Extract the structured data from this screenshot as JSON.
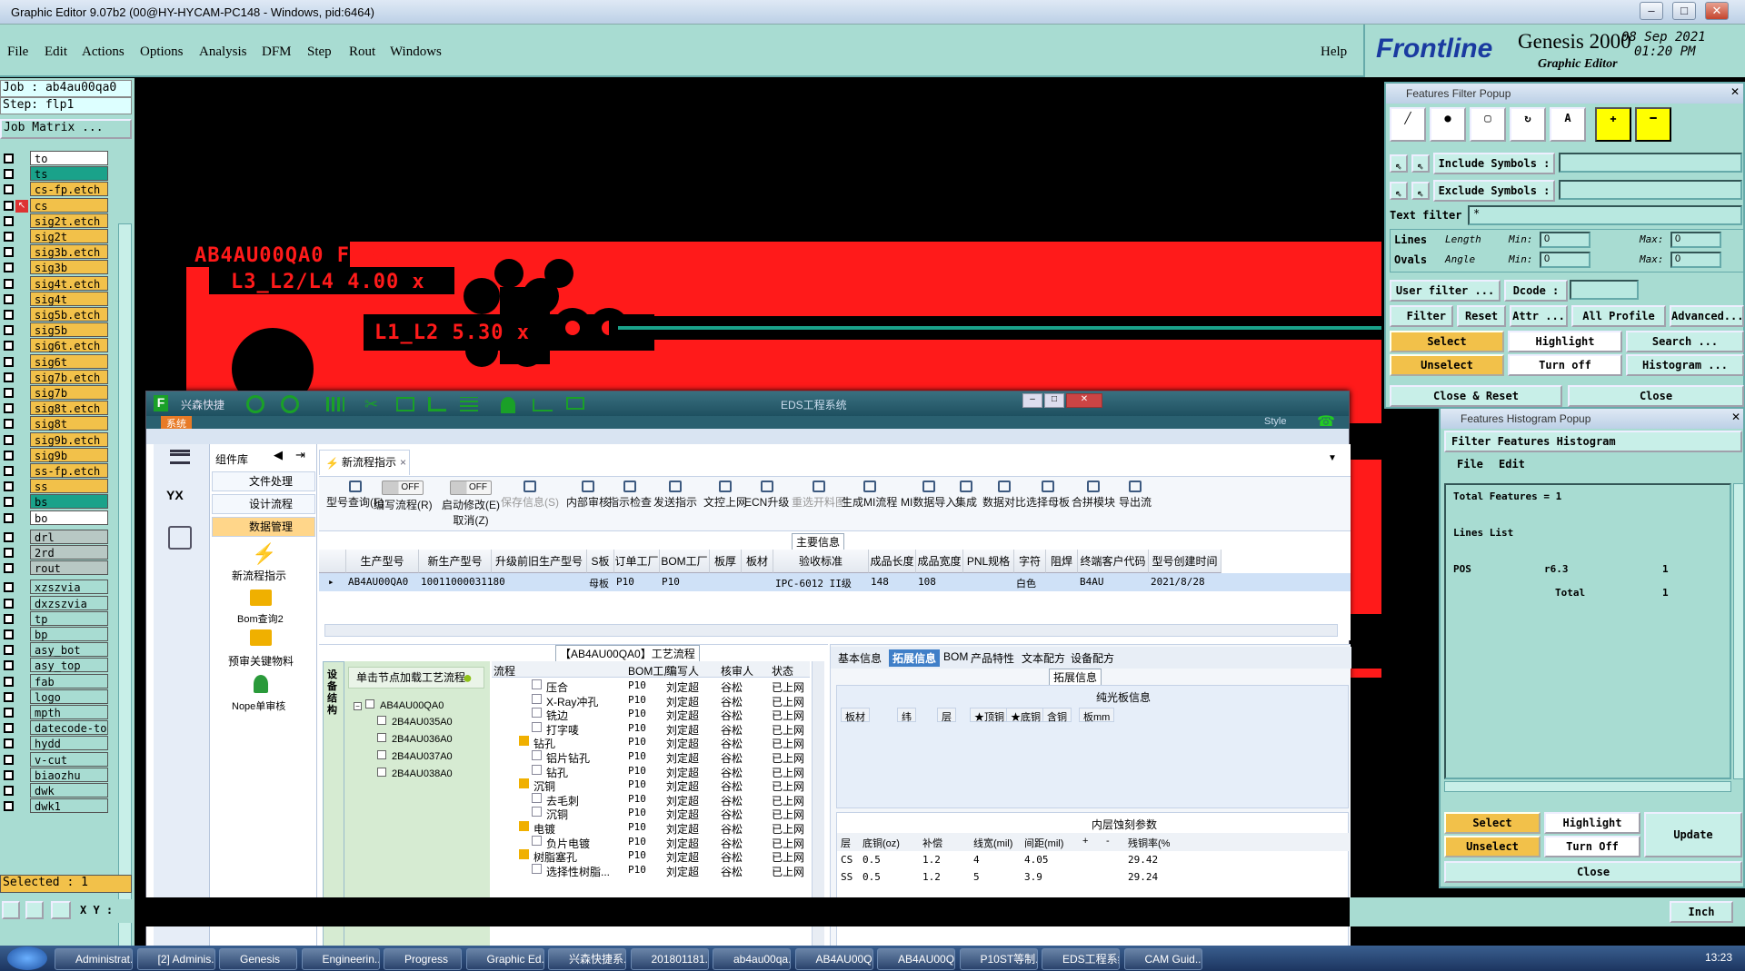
{
  "window": {
    "title": "Graphic Editor 9.07b2 (00@HY-HYCAM-PC148 - Windows, pid:6464)"
  },
  "menu": [
    "File",
    "Edit",
    "Actions",
    "Options",
    "Analysis",
    "DFM",
    "Step",
    "Rout",
    "Windows"
  ],
  "help": "Help",
  "brand": {
    "logo": "Frontline",
    "product": "Genesis 2000",
    "subtitle": "Graphic Editor",
    "date": "08 Sep 2021",
    "time": "01:20 PM"
  },
  "left": {
    "job": "Job : ab4au00qa0",
    "step": "Step: flp1",
    "matrix": "Job Matrix ...",
    "selected": "Selected : 1",
    "xy": "X Y :"
  },
  "layers": [
    {
      "name": "to",
      "color": "#ffffff"
    },
    {
      "name": "ts",
      "color": "#1aa28a"
    },
    {
      "name": "cs-fp.etch",
      "color": "#f2c14a"
    },
    {
      "name": "cs",
      "color": "#f2c14a",
      "active": true
    },
    {
      "name": "sig2t.etch",
      "color": "#f2c14a"
    },
    {
      "name": "sig2t",
      "color": "#f2c14a"
    },
    {
      "name": "sig3b.etch",
      "color": "#f2c14a"
    },
    {
      "name": "sig3b",
      "color": "#f2c14a"
    },
    {
      "name": "sig4t.etch",
      "color": "#f2c14a"
    },
    {
      "name": "sig4t",
      "color": "#f2c14a"
    },
    {
      "name": "sig5b.etch",
      "color": "#f2c14a"
    },
    {
      "name": "sig5b",
      "color": "#f2c14a"
    },
    {
      "name": "sig6t.etch",
      "color": "#f2c14a"
    },
    {
      "name": "sig6t",
      "color": "#f2c14a"
    },
    {
      "name": "sig7b.etch",
      "color": "#f2c14a"
    },
    {
      "name": "sig7b",
      "color": "#f2c14a"
    },
    {
      "name": "sig8t.etch",
      "color": "#f2c14a"
    },
    {
      "name": "sig8t",
      "color": "#f2c14a"
    },
    {
      "name": "sig9b.etch",
      "color": "#f2c14a"
    },
    {
      "name": "sig9b",
      "color": "#f2c14a"
    },
    {
      "name": "ss-fp.etch",
      "color": "#f2c14a"
    },
    {
      "name": "ss",
      "color": "#f2c14a"
    },
    {
      "name": "bs",
      "color": "#1aa28a"
    },
    {
      "name": "bo",
      "color": "#ffffff"
    },
    {
      "name": "drl",
      "color": "#b8c8c4"
    },
    {
      "name": "2rd",
      "color": "#b8c8c4"
    },
    {
      "name": "rout",
      "color": "#b8c8c4"
    },
    {
      "name": "xzszvia",
      "color": "#a8dcd2"
    },
    {
      "name": "dxzszvia",
      "color": "#a8dcd2"
    },
    {
      "name": "tp",
      "color": "#a8dcd2"
    },
    {
      "name": "bp",
      "color": "#a8dcd2"
    },
    {
      "name": "asy_bot",
      "color": "#a8dcd2"
    },
    {
      "name": "asy_top",
      "color": "#a8dcd2"
    },
    {
      "name": "fab",
      "color": "#a8dcd2"
    },
    {
      "name": "logo",
      "color": "#a8dcd2"
    },
    {
      "name": "mpth",
      "color": "#a8dcd2"
    },
    {
      "name": "datecode-to",
      "color": "#a8dcd2"
    },
    {
      "name": "hydd",
      "color": "#a8dcd2"
    },
    {
      "name": "v-cut",
      "color": "#a8dcd2"
    },
    {
      "name": "biaozhu",
      "color": "#a8dcd2"
    },
    {
      "name": "dwk",
      "color": "#a8dcd2"
    },
    {
      "name": "dwk1",
      "color": "#a8dcd2"
    }
  ],
  "board": {
    "l1": "AB4AU00QA0 FLP1",
    "l2": "L3_L2/L4 4.00 x",
    "l3": "L1_L2 5.30 x"
  },
  "eds": {
    "title": "EDS工程系统",
    "brand": "兴森快捷",
    "sys_tab": "系统",
    "style_label": "Style",
    "lib_title": "组件库",
    "lib_items": [
      "文件处理",
      "设计流程",
      "数据管理"
    ],
    "lib_icons": [
      "新流程指示",
      "Bom查询2",
      "预审关键物料",
      "Nope单审核"
    ],
    "tab": "新流程指示",
    "tools": [
      {
        "label": "型号查询(F)"
      },
      {
        "label": "编写流程(R)",
        "toggle": "OFF"
      },
      {
        "label": "启动修改(E)",
        "sub": "取消(Z)",
        "toggle": "OFF"
      },
      {
        "label": "保存信息(S)"
      },
      {
        "label": "内部审核"
      },
      {
        "label": "指示检查"
      },
      {
        "label": "发送指示"
      },
      {
        "label": "文控上网"
      },
      {
        "label": "ECN升级"
      },
      {
        "label": "重选开料图"
      },
      {
        "label": "生成MI流程"
      },
      {
        "label": "MI数据导入"
      },
      {
        "label": "集成"
      },
      {
        "label": "数据对比"
      },
      {
        "label": "选择母板"
      },
      {
        "label": "合拼模块"
      },
      {
        "label": "导出流"
      }
    ],
    "main_info": "主要信息",
    "grid_headers": [
      "生产型号",
      "新生产型号",
      "升级前旧生产型号",
      "S板",
      "订单工厂",
      "BOM工厂",
      "板厚",
      "板材",
      "验收标准",
      "成品长度",
      "成品宽度",
      "PNL规格",
      "字符",
      "阻焊",
      "终端客户代码",
      "型号创建时间"
    ],
    "grid_row": [
      "AB4AU00QA0",
      "10011000031180",
      "",
      "母板",
      "P10",
      "P10",
      "",
      "",
      "IPC-6012 II级",
      "148",
      "108",
      "",
      "白色",
      "",
      "B4AU",
      "2021/8/28"
    ],
    "flow_title": "【AB4AU00QA0】工艺流程",
    "flow_side": "设备结构",
    "tree_hint": "单击节点加载工艺流程",
    "tree_root": "AB4AU00QA0",
    "tree_children": [
      "2B4AU035A0",
      "2B4AU036A0",
      "2B4AU037A0",
      "2B4AU038A0"
    ],
    "flow_headers": [
      "流程",
      "BOM工厂",
      "编写人",
      "核审人",
      "状态"
    ],
    "flow_rows": [
      {
        "name": "压合",
        "f": "P10",
        "w": "刘定超",
        "r": "谷松",
        "s": "已上网",
        "lvl": 2
      },
      {
        "name": "X-Ray冲孔",
        "f": "P10",
        "w": "刘定超",
        "r": "谷松",
        "s": "已上网",
        "lvl": 2
      },
      {
        "name": "铣边",
        "f": "P10",
        "w": "刘定超",
        "r": "谷松",
        "s": "已上网",
        "lvl": 2
      },
      {
        "name": "打字唛",
        "f": "P10",
        "w": "刘定超",
        "r": "谷松",
        "s": "已上网",
        "lvl": 2
      },
      {
        "name": "钻孔",
        "f": "P10",
        "w": "刘定超",
        "r": "谷松",
        "s": "已上网",
        "lvl": 1
      },
      {
        "name": "铝片钻孔",
        "f": "P10",
        "w": "刘定超",
        "r": "谷松",
        "s": "已上网",
        "lvl": 2
      },
      {
        "name": "钻孔",
        "f": "P10",
        "w": "刘定超",
        "r": "谷松",
        "s": "已上网",
        "lvl": 2
      },
      {
        "name": "沉铜",
        "f": "P10",
        "w": "刘定超",
        "r": "谷松",
        "s": "已上网",
        "lvl": 1
      },
      {
        "name": "去毛刺",
        "f": "P10",
        "w": "刘定超",
        "r": "谷松",
        "s": "已上网",
        "lvl": 2
      },
      {
        "name": "沉铜",
        "f": "P10",
        "w": "刘定超",
        "r": "谷松",
        "s": "已上网",
        "lvl": 2
      },
      {
        "name": "电镀",
        "f": "P10",
        "w": "刘定超",
        "r": "谷松",
        "s": "已上网",
        "lvl": 1
      },
      {
        "name": "负片电镀",
        "f": "P10",
        "w": "刘定超",
        "r": "谷松",
        "s": "已上网",
        "lvl": 2
      },
      {
        "name": "树脂塞孔",
        "f": "P10",
        "w": "刘定超",
        "r": "谷松",
        "s": "已上网",
        "lvl": 1
      },
      {
        "name": "选择性树脂...",
        "f": "P10",
        "w": "刘定超",
        "r": "谷松",
        "s": "已上网",
        "lvl": 2
      }
    ],
    "ext_tabs": [
      "基本信息",
      "拓展信息",
      "BOM",
      "产品特性",
      "文本配方",
      "设备配方"
    ],
    "ext_label": "拓展信息",
    "panel_title": "纯光板信息",
    "panel_headers": [
      "板材",
      "纬",
      "层",
      "★顶铜",
      "★底铜",
      "含铜",
      "板mm"
    ],
    "etch_title": "内层蚀刻参数",
    "etch_headers": [
      "层",
      "底铜(oz)",
      "补偿",
      "线宽(mil)",
      "间距(mil)",
      "+",
      "-",
      "残铜率(%"
    ],
    "etch_rows": [
      [
        "CS",
        "0.5",
        "1.2",
        "4",
        "4.05",
        "",
        "",
        "29.42"
      ],
      [
        "SS",
        "0.5",
        "1.2",
        "5",
        "3.9",
        "",
        "",
        "29.24"
      ]
    ]
  },
  "ffp": {
    "title": "Features Filter Popup",
    "include": "Include Symbols :",
    "exclude": "Exclude Symbols :",
    "text_filter": "Text filter",
    "text_val": "*",
    "lines": "Lines",
    "ovals": "Ovals",
    "length": "Length",
    "angle": "Angle",
    "min": "Min:",
    "max": "Max:",
    "minv": "0",
    "maxv": "0",
    "user_filter": "User filter ...",
    "dcode": "Dcode :",
    "filter": "Filter",
    "reset": "Reset",
    "attr": "Attr ...",
    "all_profile": "All Profile",
    "advanced": "Advanced...",
    "select": "Select",
    "highlight": "Highlight",
    "search": "Search ...",
    "unselect": "Unselect",
    "turn_off": "Turn off",
    "histogram": "Histogram ...",
    "close_reset": "Close & Reset",
    "close": "Close"
  },
  "fhp": {
    "title": "Features Histogram Popup",
    "header": "Filter Features Histogram",
    "file": "File",
    "edit": "Edit",
    "total": "Total Features = 1",
    "lines_list": "Lines List",
    "pos": "POS",
    "sym": "r6.3",
    "cnt": "1",
    "total_lbl": "Total",
    "total_cnt": "1",
    "select": "Select",
    "highlight": "Highlight",
    "update": "Update",
    "unselect": "Unselect",
    "turn_off": "Turn Off",
    "close": "Close"
  },
  "units": "Inch",
  "taskbar": [
    "Administrat...",
    "[2] Adminis...",
    "Genesis",
    "Engineerin...",
    "Progress",
    "Graphic Ed...",
    "兴森快捷系...",
    "201801181...",
    "ab4au00qa...",
    "AB4AU00Q...",
    "AB4AU00Q...",
    "P10ST等制...",
    "EDS工程系统",
    "CAM Guid..."
  ],
  "clock": "13:23"
}
